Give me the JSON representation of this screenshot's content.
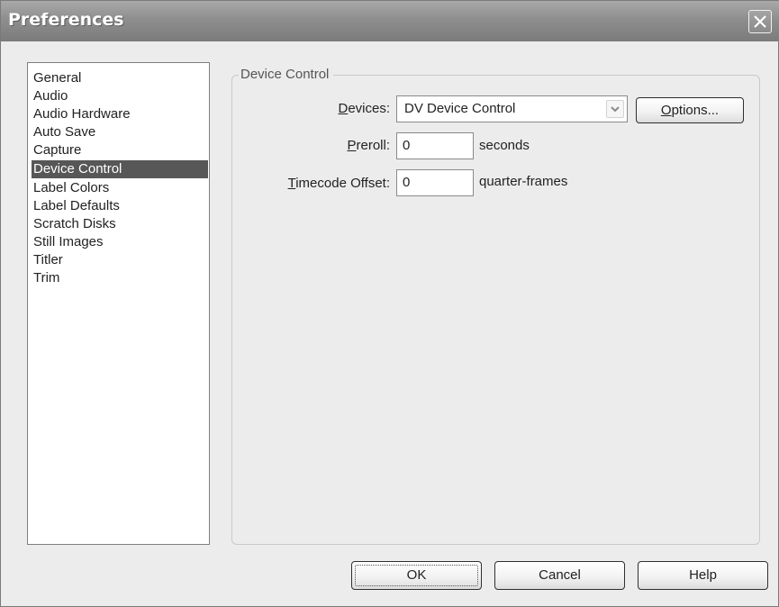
{
  "window": {
    "title": "Preferences"
  },
  "sidebar": {
    "selected": "Device Control",
    "items": [
      {
        "label": "General"
      },
      {
        "label": "Audio"
      },
      {
        "label": "Audio Hardware"
      },
      {
        "label": "Auto Save"
      },
      {
        "label": "Capture"
      },
      {
        "label": "Device Control"
      },
      {
        "label": "Label Colors"
      },
      {
        "label": "Label Defaults"
      },
      {
        "label": "Scratch Disks"
      },
      {
        "label": "Still Images"
      },
      {
        "label": "Titler"
      },
      {
        "label": "Trim"
      }
    ]
  },
  "device_control": {
    "group_title": "Device Control",
    "devices_label_mnemonic": "D",
    "devices_label_rest": "evices:",
    "devices_value": "DV Device Control",
    "options_button_mnemonic": "O",
    "options_button_rest": "ptions...",
    "preroll_label_mnemonic": "P",
    "preroll_label_rest": "reroll:",
    "preroll_value": "0",
    "preroll_unit": "seconds",
    "timecode_label_mnemonic": "T",
    "timecode_label_rest": "imecode Offset:",
    "timecode_value": "0",
    "timecode_unit": "quarter-frames"
  },
  "footer": {
    "ok_label": "OK",
    "cancel_label": "Cancel",
    "help_label": "Help"
  },
  "icons": {
    "close": "close-icon",
    "dropdown_arrow": "chevron-down-icon"
  },
  "colors": {
    "selection": "#575757",
    "titlebar": "#8e8e8e"
  }
}
